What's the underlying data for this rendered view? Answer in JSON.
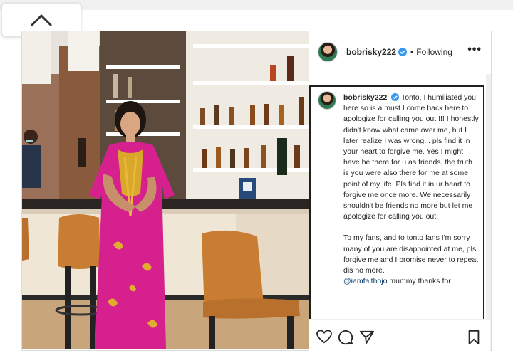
{
  "post": {
    "username": "bobrisky222",
    "separator": "•",
    "follow_status": "Following",
    "more_label": "•••",
    "caption": {
      "username": "bobrisky222",
      "paragraph1": "Tonto, I humiliated you here so is a must I come back here to apologize for calling you out !!! I honestly didn't know what came over me, but I later realize I was wrong... pls find it in your heart to forgive me. Yes I might have be there for u as friends, the truth is you were also there for me at some point of my life. Pls find it in ur heart to forgive me once more. We necessarily shouldn't be friends no more but let me apologize for calling you out.",
      "paragraph2": "To my fans, and to tonto fans I'm sorry many of you are disappointed at me, pls forgive me and I promise never to repeat dis no more.",
      "mention": "@iamfaithojo",
      "paragraph3_rest": " mummy thanks for"
    }
  },
  "icons": {
    "up": "chevron-up-icon",
    "verified": "verified-badge-icon",
    "like": "heart-icon",
    "comment": "comment-icon",
    "share": "share-icon",
    "save": "bookmark-icon"
  },
  "colors": {
    "verified": "#3897f0",
    "text": "#262626",
    "mention": "#00376b",
    "dress": "#d6208e",
    "chair": "#c97d33"
  }
}
